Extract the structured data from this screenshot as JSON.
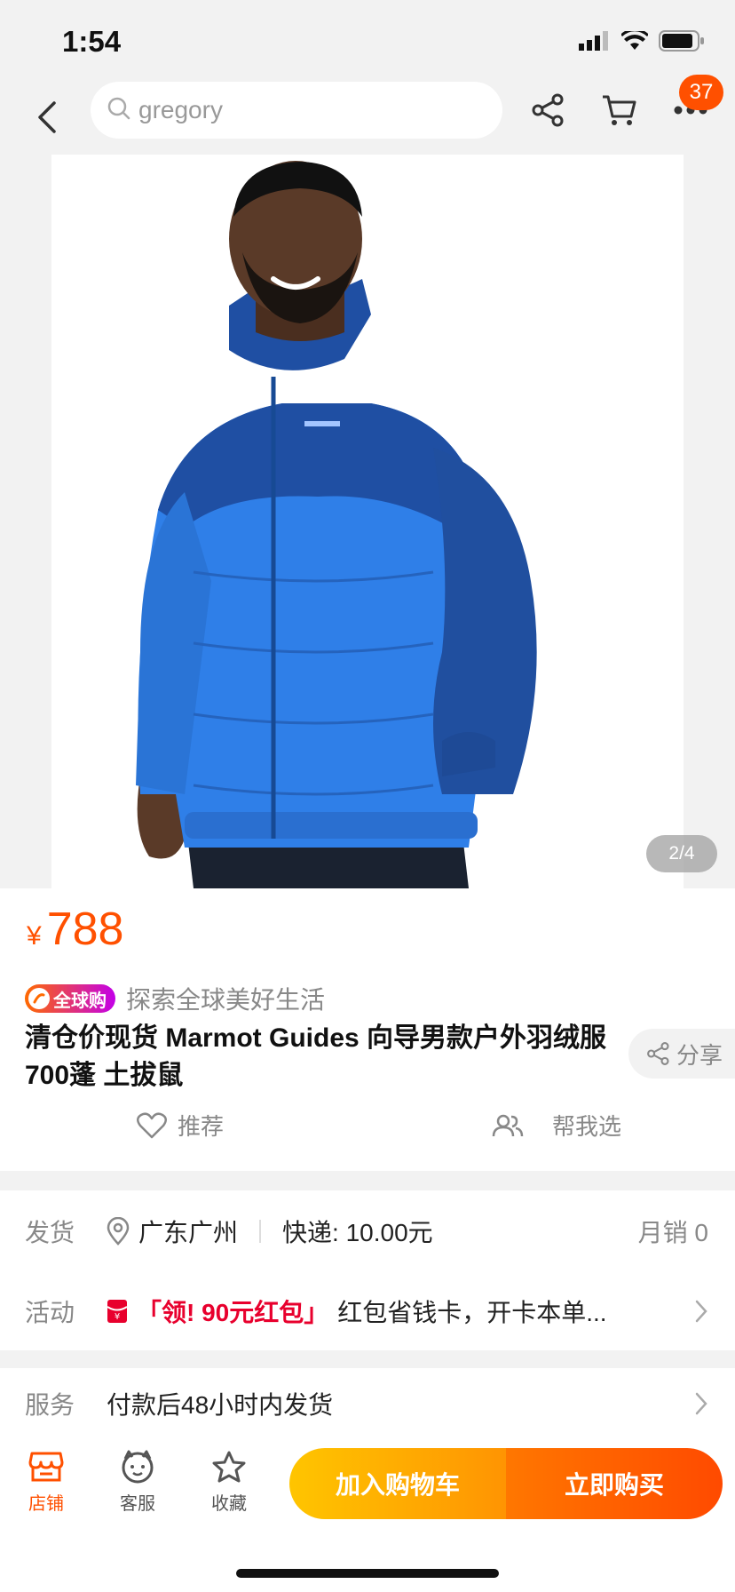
{
  "status": {
    "time": "1:54"
  },
  "nav": {
    "search_query": "gregory",
    "cart_count": "37"
  },
  "gallery": {
    "page_indicator": "2/4"
  },
  "product": {
    "price_symbol": "¥",
    "price": "788",
    "global_badge": "全球购",
    "global_slogan": "探索全球美好生活",
    "title": "清仓价现货 Marmot Guides  向导男款户外羽绒服 700蓬 土拔鼠",
    "share_label": "分享",
    "recommend_label": "推荐",
    "help_choose_label": "帮我选"
  },
  "shipping": {
    "label": "发货",
    "location": "广东广州",
    "express": "快递: 10.00元",
    "monthly_sales": "月销 0"
  },
  "promotion": {
    "label": "活动",
    "highlight": "「领! 90元红包」",
    "text": "红包省钱卡，开卡本单..."
  },
  "service": {
    "label": "服务",
    "text": "付款后48小时内发货"
  },
  "bottom_bar": {
    "shop_label": "店铺",
    "service_label": "客服",
    "favorite_label": "收藏",
    "add_to_cart_label": "加入购物车",
    "buy_now_label": "立即购买"
  },
  "colors": {
    "accent": "#ff5000",
    "cart_button": "#ffc500",
    "buy_button": "#ff4a00",
    "jacket_main": "#2f7fe8",
    "jacket_shoulder": "#1f4fa3"
  }
}
